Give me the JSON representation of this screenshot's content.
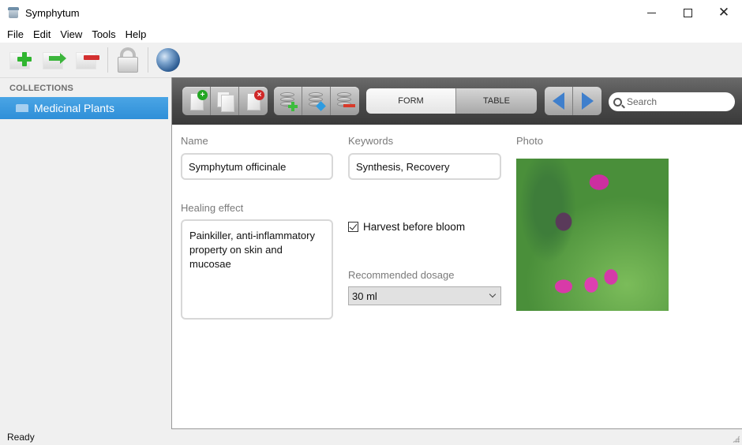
{
  "window": {
    "title": "Symphytum",
    "controls": [
      "minimize",
      "maximize",
      "close"
    ]
  },
  "menu": {
    "items": [
      "File",
      "Edit",
      "View",
      "Tools",
      "Help"
    ]
  },
  "main_toolbar": {
    "buttons": [
      {
        "name": "new-collection",
        "icon": "add-collection-icon"
      },
      {
        "name": "duplicate-collection",
        "icon": "duplicate-collection-icon"
      },
      {
        "name": "delete-collection",
        "icon": "delete-collection-icon"
      },
      {
        "name": "lock",
        "icon": "lock-icon"
      },
      {
        "name": "sync",
        "icon": "globe-icon"
      }
    ]
  },
  "sidebar": {
    "header": "COLLECTIONS",
    "items": [
      {
        "label": "Medicinal Plants",
        "selected": true
      }
    ]
  },
  "view_toolbar": {
    "record_buttons": [
      "new-record",
      "duplicate-record",
      "delete-record"
    ],
    "field_buttons": [
      "add-field",
      "modify-field",
      "delete-field"
    ],
    "view_modes": {
      "form": "FORM",
      "table": "TABLE",
      "active": "FORM"
    },
    "navigation": [
      "previous-record",
      "next-record"
    ],
    "search": {
      "placeholder": "Search",
      "value": ""
    }
  },
  "form": {
    "name": {
      "label": "Name",
      "value": "Symphytum officinale"
    },
    "keywords": {
      "label": "Keywords",
      "value": "Synthesis, Recovery"
    },
    "photo": {
      "label": "Photo",
      "description": "Comfrey flower photo"
    },
    "healing_effect": {
      "label": "Healing effect",
      "value": "Painkiller, anti-inflammatory property on skin and mucosae"
    },
    "harvest": {
      "label": "Harvest before bloom",
      "checked": true
    },
    "dosage": {
      "label": "Recommended dosage",
      "value": "30 ml"
    }
  },
  "status": {
    "text": "Ready"
  },
  "colors": {
    "selection": "#2f8fd8",
    "dark_toolbar": "#4a4a4a",
    "nav_arrow": "#3f7fcc"
  }
}
